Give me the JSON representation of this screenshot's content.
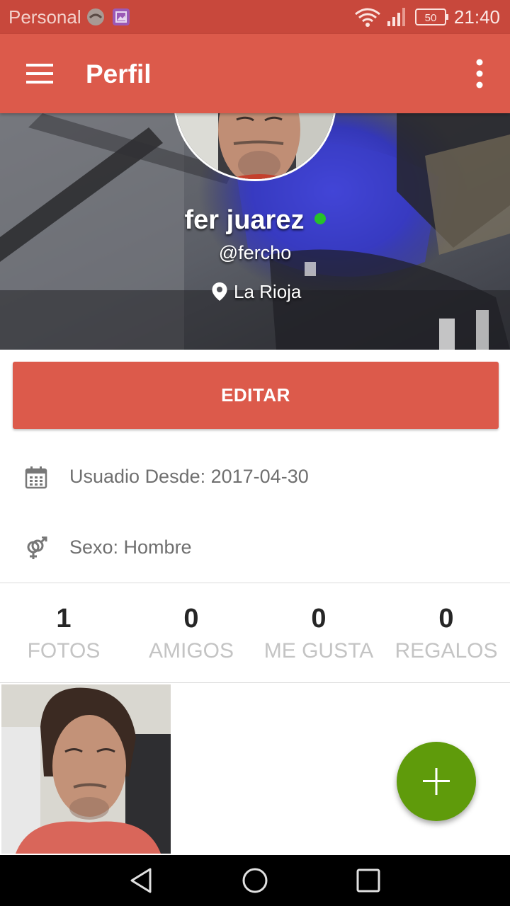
{
  "status_bar": {
    "carrier": "Personal",
    "battery": "50",
    "time": "21:40"
  },
  "toolbar": {
    "title": "Perfil"
  },
  "profile": {
    "name": "fer juarez",
    "username": "@fercho",
    "location": "La Rioja",
    "online": true
  },
  "edit_button": {
    "label": "EDITAR"
  },
  "info": {
    "member_since": "Usuadio Desde: 2017-04-30",
    "sex": "Sexo: Hombre"
  },
  "stats": [
    {
      "value": "1",
      "label": "FOTOS"
    },
    {
      "value": "0",
      "label": "AMIGOS"
    },
    {
      "value": "0",
      "label": "ME GUSTA"
    },
    {
      "value": "0",
      "label": "REGALOS"
    }
  ],
  "colors": {
    "status_bar": "#c8483c",
    "primary": "#dc5a4b",
    "fab": "#5f9b0b",
    "online": "#26c12a"
  },
  "icons": {
    "menu": "menu-icon",
    "more": "more-vert-icon",
    "location": "location-pin-icon",
    "calendar": "calendar-icon",
    "gender": "gender-icon",
    "add": "plus-icon"
  }
}
